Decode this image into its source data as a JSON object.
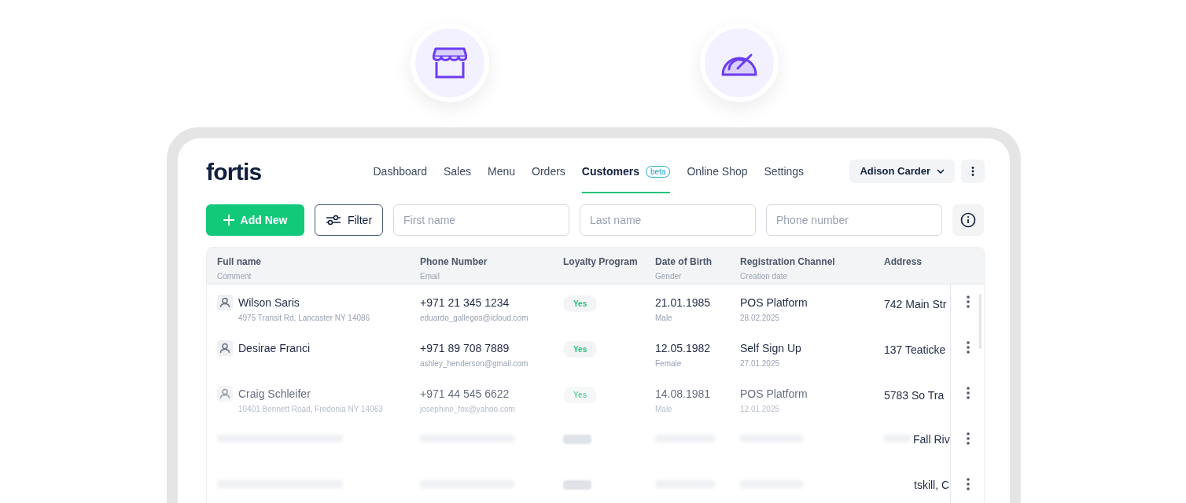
{
  "logo": "fortis",
  "nav": [
    {
      "label": "Dashboard",
      "selected": false
    },
    {
      "label": "Sales",
      "selected": false
    },
    {
      "label": "Menu",
      "selected": false
    },
    {
      "label": "Orders",
      "selected": false
    },
    {
      "label": "Customers",
      "badge": "beta",
      "selected": true
    },
    {
      "label": "Online Shop",
      "selected": false
    },
    {
      "label": "Settings",
      "selected": false
    }
  ],
  "user": "Adison Carder",
  "toolbar": {
    "add_button": "Add New",
    "filter_button": "Filter",
    "fields": [
      {
        "placeholder": "First name"
      },
      {
        "placeholder": "Last name"
      },
      {
        "placeholder": "Phone number"
      }
    ]
  },
  "table": {
    "columns": [
      {
        "title": "Full name",
        "subtitle": "Comment"
      },
      {
        "title": "Phone Number",
        "subtitle": "Email"
      },
      {
        "title": "Loyalty Program"
      },
      {
        "title": "Date of Birth",
        "subtitle": "Gender"
      },
      {
        "title": "Registration Channel",
        "subtitle": "Creation date"
      },
      {
        "title": "Address"
      }
    ],
    "rows": [
      {
        "name": "Wilson Saris",
        "comment": "4975 Transit Rd, Lancaster NY 14086",
        "phone": "+971 21 345 1234",
        "email": "eduardo_gallegos@icloud.com",
        "loyalty": "Yes",
        "dob": "21.01.1985",
        "gender": "Male",
        "channel": "POS Platform",
        "created": "28.02.2025",
        "address": "742 Main Str"
      },
      {
        "name": "Desirae Franci",
        "phone": "+971 89 708 7889",
        "email": "ashley_henderson@gmail.com",
        "loyalty": "Yes",
        "dob": "12.05.1982",
        "gender": "Female",
        "channel": "Self Sign Up",
        "created": "27.01.2025",
        "address": "137 Teaticke"
      },
      {
        "name": "Craig Schleifer",
        "comment": "10401 Bennett Road, Fredonia NY 14063",
        "phone": "+971 44 545 6622",
        "email": "josephine_fox@yahoo.com",
        "loyalty": "Yes",
        "dob": "14.08.1981",
        "gender": "Male",
        "channel": "POS Platform",
        "created": "12.01.2025",
        "address": "5783 So Tra"
      },
      {
        "kind": "blurred",
        "address": "Fall Riv"
      },
      {
        "kind": "blurred",
        "address": "tskill, C"
      }
    ]
  }
}
